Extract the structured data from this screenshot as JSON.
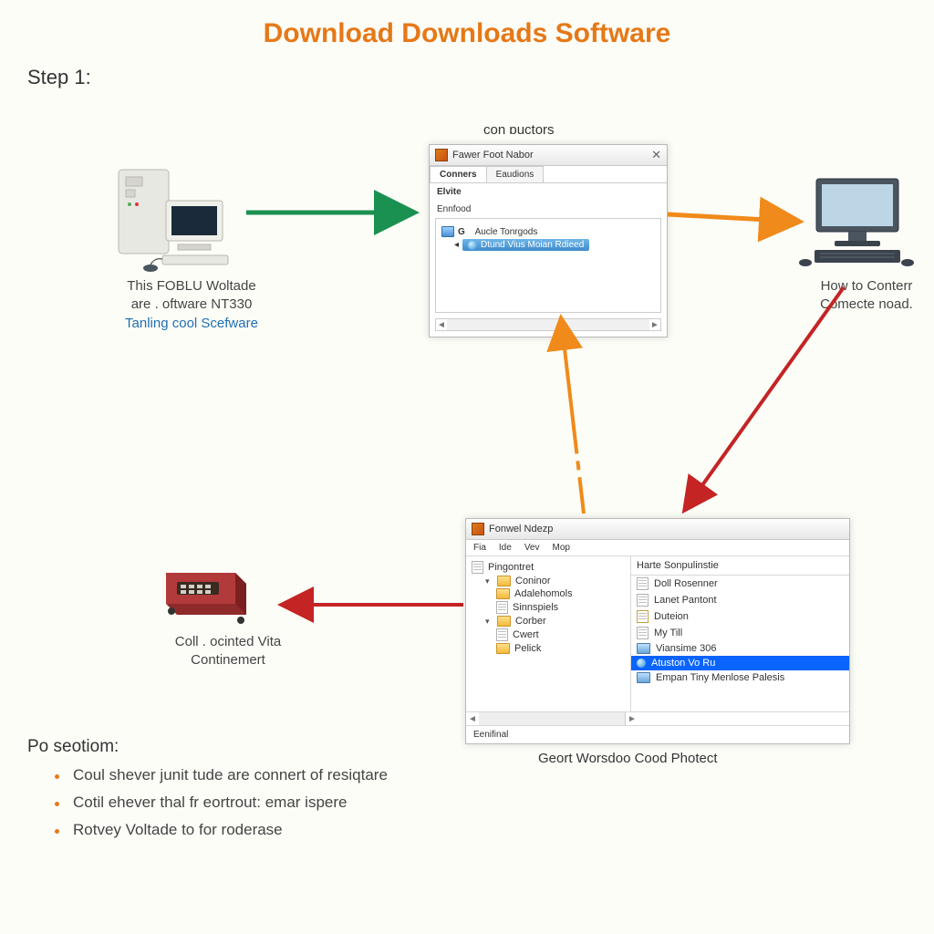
{
  "title": "Download Downloads Software",
  "step_label": "Step 1:",
  "nodes": {
    "server": {
      "line1": "This FOBLU Woltade",
      "line2": "are . oftware NT330",
      "line3": "Tanling cool Scefware"
    },
    "pc": {
      "line1": "How to Conterr",
      "line2": "Comecte noad."
    },
    "device": {
      "line1": "Coll . ocinted Vita",
      "line2": "Continemert"
    }
  },
  "dlg1": {
    "label_above": "con ɒuctors",
    "title": "Fawer Foot Nabor",
    "tab1": "Conners",
    "tab2": "Eaudions",
    "section1": "Elvite",
    "section2": "Ennfood",
    "tree_root": "Aucle Tonrgods",
    "tree_selected": "Dtund Vius Moian Rdieed"
  },
  "dlg2": {
    "title": "Fonwel Ndezp",
    "menu": [
      "Fia",
      "Ide",
      "Vev",
      "Mop"
    ],
    "left_root": "Pingontret",
    "left_items": [
      {
        "label": "Coninor",
        "folder": true,
        "level": 1
      },
      {
        "label": "Adalehomols",
        "folder": true,
        "level": 2
      },
      {
        "label": "Sinnspiels",
        "folder": false,
        "level": 2
      },
      {
        "label": "Corber",
        "folder": true,
        "level": 1
      },
      {
        "label": "Cwert",
        "folder": false,
        "level": 2
      },
      {
        "label": "Pelick",
        "folder": true,
        "level": 2
      }
    ],
    "right_header": "Harte Sonpulinstie",
    "right_items": [
      "Doll Rosenner",
      "Lanet Pantont",
      "Duteion",
      "My Till",
      "Viansime 306",
      "Atuston Vo Ru",
      "Empan Tiny Menlose Palesis"
    ],
    "right_selected_index": 5,
    "status": "Eenifinal",
    "caption": "Geort Worsdoo Cood Photect"
  },
  "footer": {
    "heading": "Po seotiom:",
    "bullets": [
      "Coul shever junit tude are connert of resiqtare",
      "Cotil ehever thal fr eortrout: emar ispere",
      "Rotvey Voltade to for roderase"
    ]
  }
}
